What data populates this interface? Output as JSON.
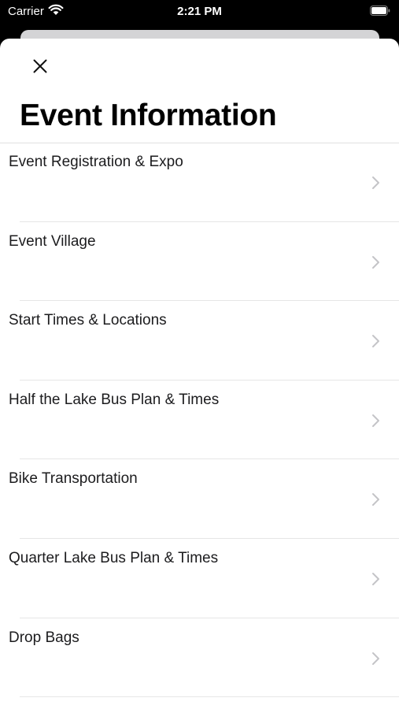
{
  "status_bar": {
    "carrier": "Carrier",
    "time": "2:21 PM"
  },
  "header": {
    "title": "Event Information"
  },
  "list": {
    "items": [
      {
        "label": "Event Registration & Expo"
      },
      {
        "label": "Event Village"
      },
      {
        "label": "Start Times & Locations"
      },
      {
        "label": "Half the Lake Bus Plan & Times"
      },
      {
        "label": "Bike Transportation"
      },
      {
        "label": "Quarter Lake Bus Plan & Times"
      },
      {
        "label": "Drop Bags"
      }
    ]
  },
  "icons": {
    "wifi": "wifi-icon",
    "battery": "battery-icon",
    "close": "close-icon",
    "chevron": "chevron-right-icon"
  },
  "colors": {
    "chevron": "#c4c4c7",
    "separator": "#e6e6e6",
    "text": "#1c1c1e"
  }
}
